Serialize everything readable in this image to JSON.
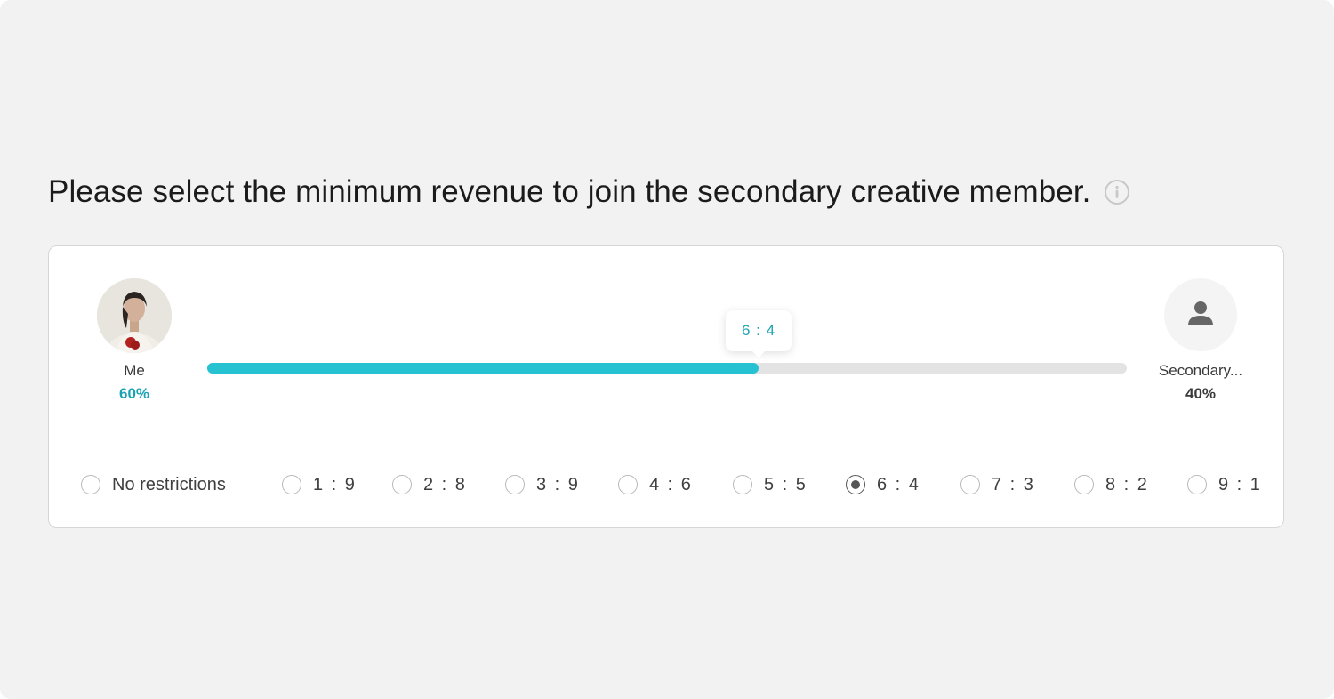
{
  "heading": {
    "text": "Please select the minimum revenue to join the secondary creative member.",
    "info_icon": "info-icon"
  },
  "members": {
    "me": {
      "name": "Me",
      "percent": "60%"
    },
    "secondary": {
      "name": "Secondary...",
      "percent": "40%"
    }
  },
  "slider": {
    "tooltip": "6 : 4",
    "value_fraction": 0.6
  },
  "options": [
    {
      "label": "No restrictions",
      "checked": false
    },
    {
      "label": "1 : 9",
      "checked": false
    },
    {
      "label": "2 : 8",
      "checked": false
    },
    {
      "label": "3 : 9",
      "checked": false
    },
    {
      "label": "4 : 6",
      "checked": false
    },
    {
      "label": "5 : 5",
      "checked": false
    },
    {
      "label": "6 : 4",
      "checked": true
    },
    {
      "label": "7 : 3",
      "checked": false
    },
    {
      "label": "8 : 2",
      "checked": false
    },
    {
      "label": "9 : 1",
      "checked": false
    }
  ],
  "colors": {
    "accent": "#26c2d1",
    "accent_text": "#1aa3b3",
    "track": "#e3e3e3",
    "background": "#f2f2f2"
  }
}
